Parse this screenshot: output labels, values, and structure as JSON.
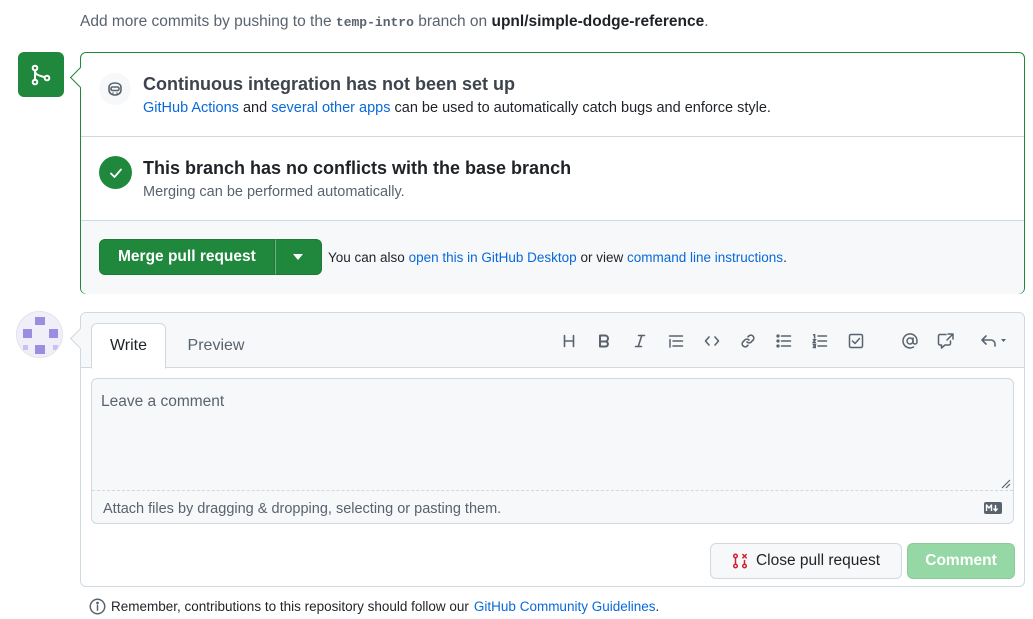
{
  "top_hint": {
    "prefix": "Add more commits by pushing to the",
    "branch": "temp-intro",
    "middle": "branch on",
    "repo": "upnl/simple-dodge-reference",
    "suffix": "."
  },
  "ci": {
    "title": "Continuous integration has not been set up",
    "link_actions": "GitHub Actions",
    "text_and": "and",
    "link_apps": "several other apps",
    "text_rest": "can be used to automatically catch bugs and enforce style."
  },
  "conflicts": {
    "title": "This branch has no conflicts with the base branch",
    "subtitle": "Merging can be performed automatically."
  },
  "merge": {
    "button_label": "Merge pull request",
    "note_prefix": "You can also",
    "link_desktop": "open this in GitHub Desktop",
    "note_middle": "or view",
    "link_cli": "command line instructions",
    "note_suffix": "."
  },
  "comment": {
    "tab_write": "Write",
    "tab_preview": "Preview",
    "placeholder": "Leave a comment",
    "attach_text": "Attach files by dragging & dropping, selecting or pasting them.",
    "close_label": "Close pull request",
    "comment_label": "Comment"
  },
  "remember": {
    "text": "Remember, contributions to this repository should follow our",
    "link": "GitHub Community Guidelines",
    "suffix": "."
  },
  "colors": {
    "green": "#1f883d",
    "link": "#0969da",
    "disabled_green": "#95d8a6"
  }
}
